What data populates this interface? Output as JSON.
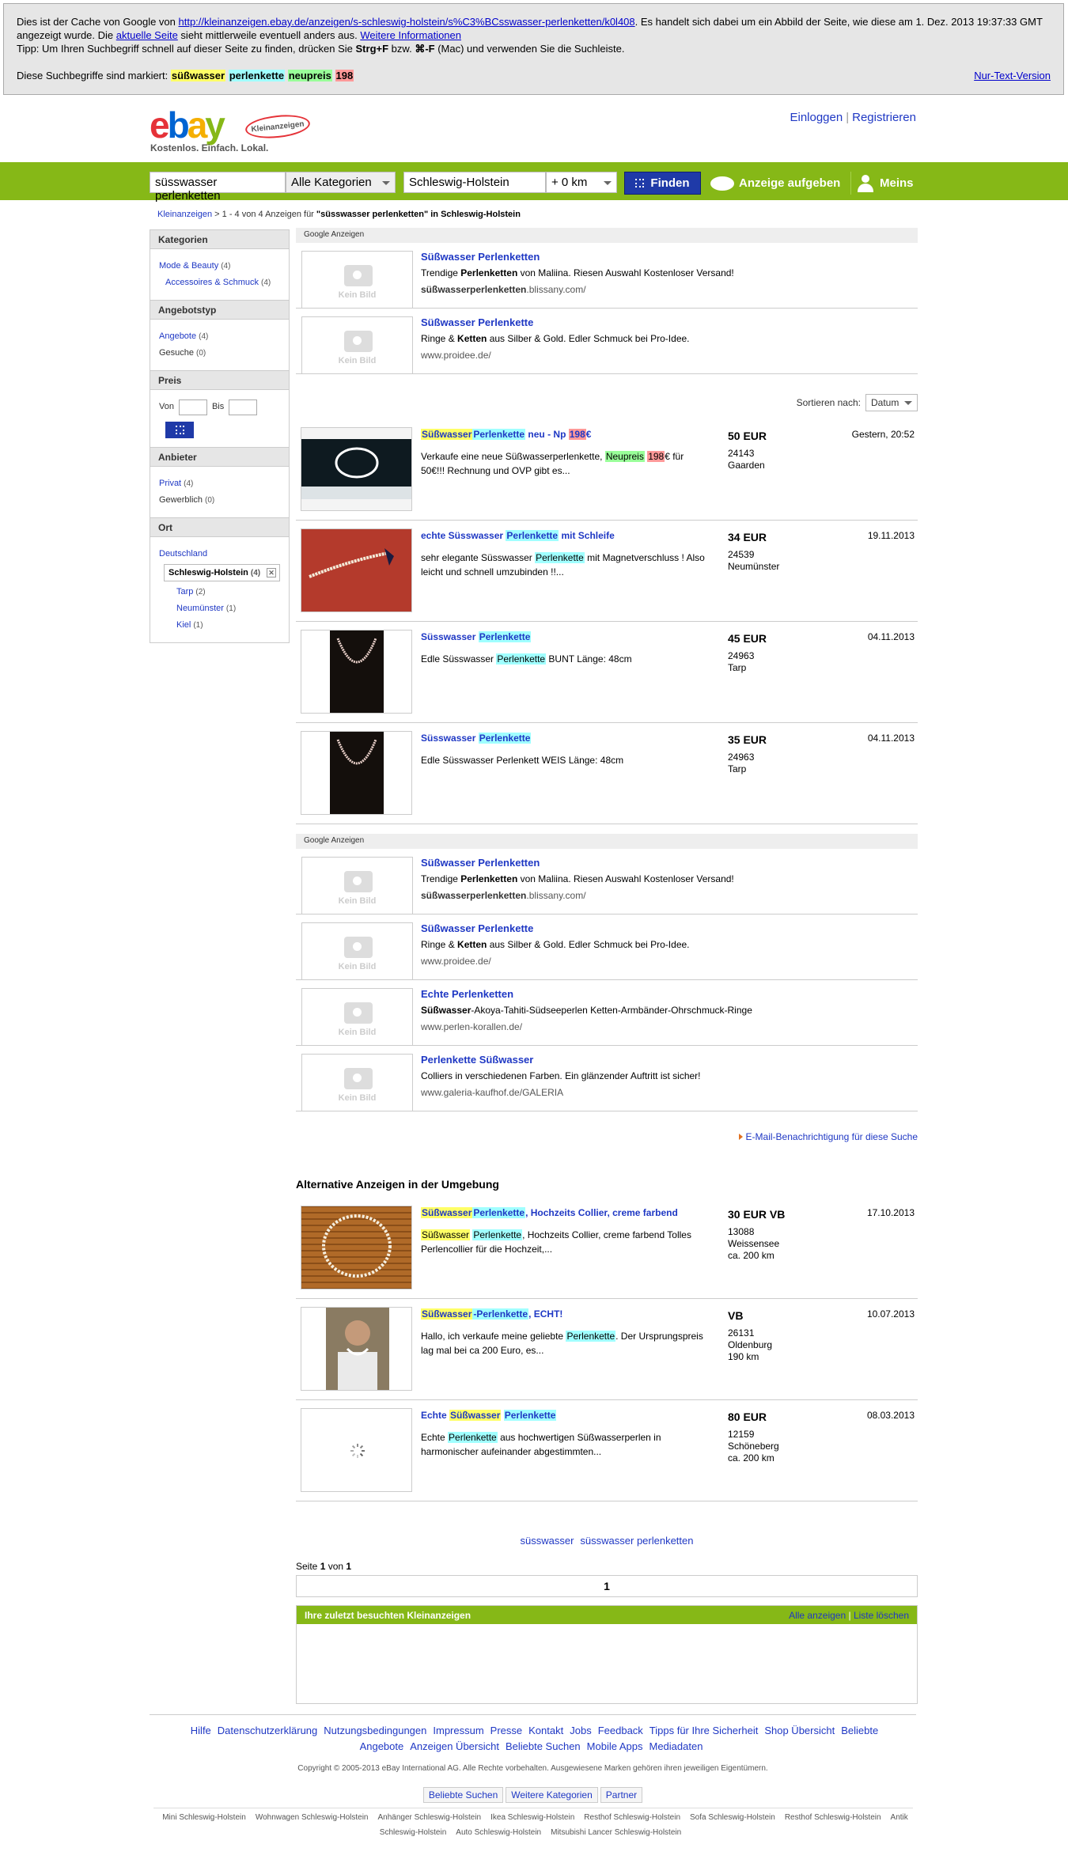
{
  "cache": {
    "line1_pre": "Dies ist der Cache von Google von ",
    "url": "http://kleinanzeigen.ebay.de/anzeigen/s-schleswig-holstein/s%C3%BCsswasser-perlenketten/k0l408",
    "line1_post": ". Es handelt sich dabei um ein Abbild der Seite, wie diese am 1. Dez. 2013 19:37:33 GMT",
    "line2_pre": "angezeigt wurde. Die ",
    "current_page_link": "aktuelle Seite",
    "line2_mid": " sieht mittlerweile eventuell anders aus. ",
    "more_info_link": "Weitere Informationen",
    "line3_pre": "Tipp: Um Ihren Suchbegriff schnell auf dieser Seite zu finden, drücken Sie ",
    "line3_key1": "Strg+F",
    "line3_mid": " bzw. ",
    "line3_key2": "⌘-F",
    "line3_post": " (Mac) und verwenden Sie die Suchleiste.",
    "marked_label": "Diese Suchbegriffe sind markiert: ",
    "terms": [
      "süßwasser",
      "perlenkette",
      "neupreis",
      "198"
    ],
    "text_only_link": "Nur-Text-Version"
  },
  "header": {
    "logo_letters": [
      "e",
      "b",
      "a",
      "y"
    ],
    "badge": "Kleinanzeigen",
    "tagline": "Kostenlos. Einfach. Lokal.",
    "login": "Einloggen",
    "sep": "|",
    "register": "Registrieren"
  },
  "searchbar": {
    "query": "süsswasser perlenketten",
    "category": "Alle Kategorien",
    "location": "Schleswig-Holstein",
    "radius": "+ 0 km",
    "find": "Finden",
    "post_ad": "Anzeige aufgeben",
    "meins": "Meins"
  },
  "breadcrumb": {
    "root": "Kleinanzeigen",
    "text": " > 1 - 4 von 4 Anzeigen für ",
    "query": "\"süsswasser perlenketten\" in Schleswig-Holstein"
  },
  "sidebar": {
    "kategorien": {
      "title": "Kategorien",
      "items": [
        {
          "label": "Mode & Beauty",
          "count": "(4)"
        },
        {
          "label": "Accessoires & Schmuck",
          "count": "(4)"
        }
      ]
    },
    "angebotstyp": {
      "title": "Angebotstyp",
      "items": [
        {
          "label": "Angebote",
          "count": "(4)"
        },
        {
          "label": "Gesuche",
          "count": "(0)"
        }
      ]
    },
    "preis": {
      "title": "Preis",
      "von": "Von",
      "bis": "Bis"
    },
    "anbieter": {
      "title": "Anbieter",
      "items": [
        {
          "label": "Privat",
          "count": "(4)"
        },
        {
          "label": "Gewerblich",
          "count": "(0)"
        }
      ]
    },
    "ort": {
      "title": "Ort",
      "country": "Deutschland",
      "selected": {
        "label": "Schleswig-Holstein",
        "count": "(4)"
      },
      "items": [
        {
          "label": "Tarp",
          "count": "(2)"
        },
        {
          "label": "Neumünster",
          "count": "(1)"
        },
        {
          "label": "Kiel",
          "count": "(1)"
        }
      ]
    }
  },
  "google_ads_label": "Google Anzeigen",
  "no_image": "Kein Bild",
  "ads_top": [
    {
      "title": "Süßwasser Perlenketten",
      "desc_a": "Trendige ",
      "desc_b": "Perlenketten",
      "desc_c": " von Maliina. Riesen Auswahl Kostenloser Versand!",
      "url_b": "süßwasserperlenketten",
      "url_c": ".blissany.com/"
    },
    {
      "title": "Süßwasser Perlenkette",
      "desc_a": "Ringe & ",
      "desc_b": "Ketten",
      "desc_c": " aus Silber & Gold. Edler Schmuck bei Pro-Idee.",
      "url_b": "",
      "url_c": "www.proidee.de/"
    }
  ],
  "sort": {
    "label": "Sortieren nach:",
    "value": "Datum"
  },
  "listings": [
    {
      "t1": "Süßwasser",
      "t2": "Perlenkette",
      "t3": " neu - Np ",
      "t4": "198",
      "t5": "€",
      "d1": "Verkaufe eine neue Süßwasserperlenkette, ",
      "d2": "Neupreis",
      "d3": " ",
      "d4": "198",
      "d5": "€ für 50€!!! Rechnung und OVP gibt es...",
      "price": "50 EUR",
      "zip": "24143",
      "city": "Gaarden",
      "dist": "",
      "date": "Gestern, 20:52",
      "thumb": "black-box"
    },
    {
      "t1": "echte Süsswasser ",
      "t2": "Perlenkette",
      "t3": " mit Schleife",
      "t4": "",
      "t5": "",
      "d1": "sehr elegante Süsswasser ",
      "d2": "Perlenkette",
      "d3": " mit Magnetverschluss ! Also leicht und schnell umzubinden !!...",
      "d4": "",
      "d5": "",
      "price": "34 EUR",
      "zip": "24539",
      "city": "Neumünster",
      "dist": "",
      "date": "19.11.2013",
      "thumb": "red-cloth"
    },
    {
      "t1": "Süsswasser ",
      "t2": "Perlenkette",
      "t3": "",
      "t4": "",
      "t5": "",
      "d1": "Edle Süsswasser ",
      "d2": "Perlenkette",
      "d3": " BUNT Länge: 48cm",
      "d4": "",
      "d5": "",
      "price": "45 EUR",
      "zip": "24963",
      "city": "Tarp",
      "dist": "",
      "date": "04.11.2013",
      "thumb": "dark-box"
    },
    {
      "t1": "Süsswasser ",
      "t2": "Perlenkette",
      "t3": "",
      "t4": "",
      "t5": "",
      "d1": "Edle Süsswasser Perlenkett WEIS Länge: 48cm",
      "d2": "",
      "d3": "",
      "d4": "",
      "d5": "",
      "price": "35 EUR",
      "zip": "24963",
      "city": "Tarp",
      "dist": "",
      "date": "04.11.2013",
      "thumb": "dark-box"
    }
  ],
  "ads_bottom": [
    {
      "title": "Süßwasser Perlenketten",
      "desc_a": "Trendige ",
      "desc_b": "Perlenketten",
      "desc_c": " von Maliina. Riesen Auswahl Kostenloser Versand!",
      "url_b": "süßwasserperlenketten",
      "url_c": ".blissany.com/"
    },
    {
      "title": "Süßwasser Perlenkette",
      "desc_a": "Ringe & ",
      "desc_b": "Ketten",
      "desc_c": " aus Silber & Gold. Edler Schmuck bei Pro-Idee.",
      "url_b": "",
      "url_c": "www.proidee.de/"
    },
    {
      "title": "Echte Perlenketten",
      "desc_a": "",
      "desc_b": "Süßwasser",
      "desc_c": "-Akoya-Tahiti-Südseeperlen Ketten-Armbänder-Ohrschmuck-Ringe",
      "url_b": "",
      "url_c": "www.perlen-korallen.de/"
    },
    {
      "title": "Perlenkette Süßwasser",
      "desc_a": "Colliers in verschiedenen Farben. Ein glänzender Auftritt ist sicher!",
      "desc_b": "",
      "desc_c": "",
      "url_b": "",
      "url_c": "www.galeria-kaufhof.de/GALERIA"
    }
  ],
  "email_alert": "E-Mail-Benachrichtigung für diese Suche",
  "alt_heading": "Alternative Anzeigen in der Umgebung",
  "alt_listings": [
    {
      "t1": "Süßwasser",
      "t2": "Perlenkette",
      "t3": ", Hochzeits Collier, creme farbend",
      "t4": "",
      "t5": "",
      "d1": "",
      "d2": "Süßwasser",
      "d3": " ",
      "d4": "Perlenkette",
      "d5": ", Hochzeits Collier, creme farbend Tolles Perlencollier für die Hochzeit,...",
      "price": "30 EUR VB",
      "zip": "13088",
      "city": "Weissensee",
      "dist": "ca. 200 km",
      "date": "17.10.2013",
      "thumb": "bamboo"
    },
    {
      "t1": "Süßwasser",
      "t2": "-Perlenkette",
      "t3": ", ECHT!",
      "t4": "",
      "t5": "",
      "d1": "Hallo, ich verkaufe meine geliebte ",
      "d2": "Perlenkette",
      "d3": ". Der Ursprungspreis lag mal bei ca 200 Euro, es...",
      "d4": "",
      "d5": "",
      "price": "VB",
      "zip": "26131",
      "city": "Oldenburg",
      "dist": "190 km",
      "date": "10.07.2013",
      "thumb": "person"
    },
    {
      "t1": "Echte ",
      "t2": "Süßwasser",
      "t3": " ",
      "t4": "Perlenkette",
      "t5": "",
      "d1": "Echte ",
      "d2": "Perlenkette",
      "d3": " aus hochwertigen Süßwasserperlen in harmonischer aufeinander abgestimmten...",
      "d4": "",
      "d5": "",
      "price": "80 EUR",
      "zip": "12159",
      "city": "Schöneberg",
      "dist": "ca. 200 km",
      "date": "08.03.2013",
      "thumb": "loading"
    }
  ],
  "related_searches": [
    "süsswasser",
    "süsswasser perlenketten"
  ],
  "pager": {
    "label_a": "Seite ",
    "page": "1",
    "label_b": " von ",
    "total": "1",
    "current": "1"
  },
  "recent": {
    "title": "Ihre zuletzt besuchten Kleinanzeigen",
    "show_all": "Alle anzeigen",
    "sep": "|",
    "clear": "Liste löschen"
  },
  "footer": {
    "links": [
      "Hilfe",
      "Datenschutzerklärung",
      "Nutzungsbedingungen",
      "Impressum",
      "Presse",
      "Kontakt",
      "Jobs",
      "Feedback",
      "Tipps für Ihre Sicherheit",
      "Shop Übersicht",
      "Beliebte Angebote",
      "Anzeigen Übersicht",
      "Beliebte Suchen",
      "Mobile Apps",
      "Mediadaten"
    ],
    "copyright": "Copyright © 2005-2013 eBay International AG. Alle Rechte vorbehalten. Ausgewiesene Marken gehören ihren jeweiligen Eigentümern.",
    "tabs": [
      "Beliebte Suchen",
      "Weitere Kategorien",
      "Partner"
    ],
    "misc": [
      "Mini Schleswig-Holstein",
      "Wohnwagen Schleswig-Holstein",
      "Anhänger Schleswig-Holstein",
      "Ikea Schleswig-Holstein",
      "Resthof Schleswig-Holstein",
      "Sofa Schleswig-Holstein",
      "Resthof Schleswig-Holstein",
      "Antik Schleswig-Holstein",
      "Auto Schleswig-Holstein",
      "Mitsubishi Lancer Schleswig-Holstein"
    ]
  }
}
